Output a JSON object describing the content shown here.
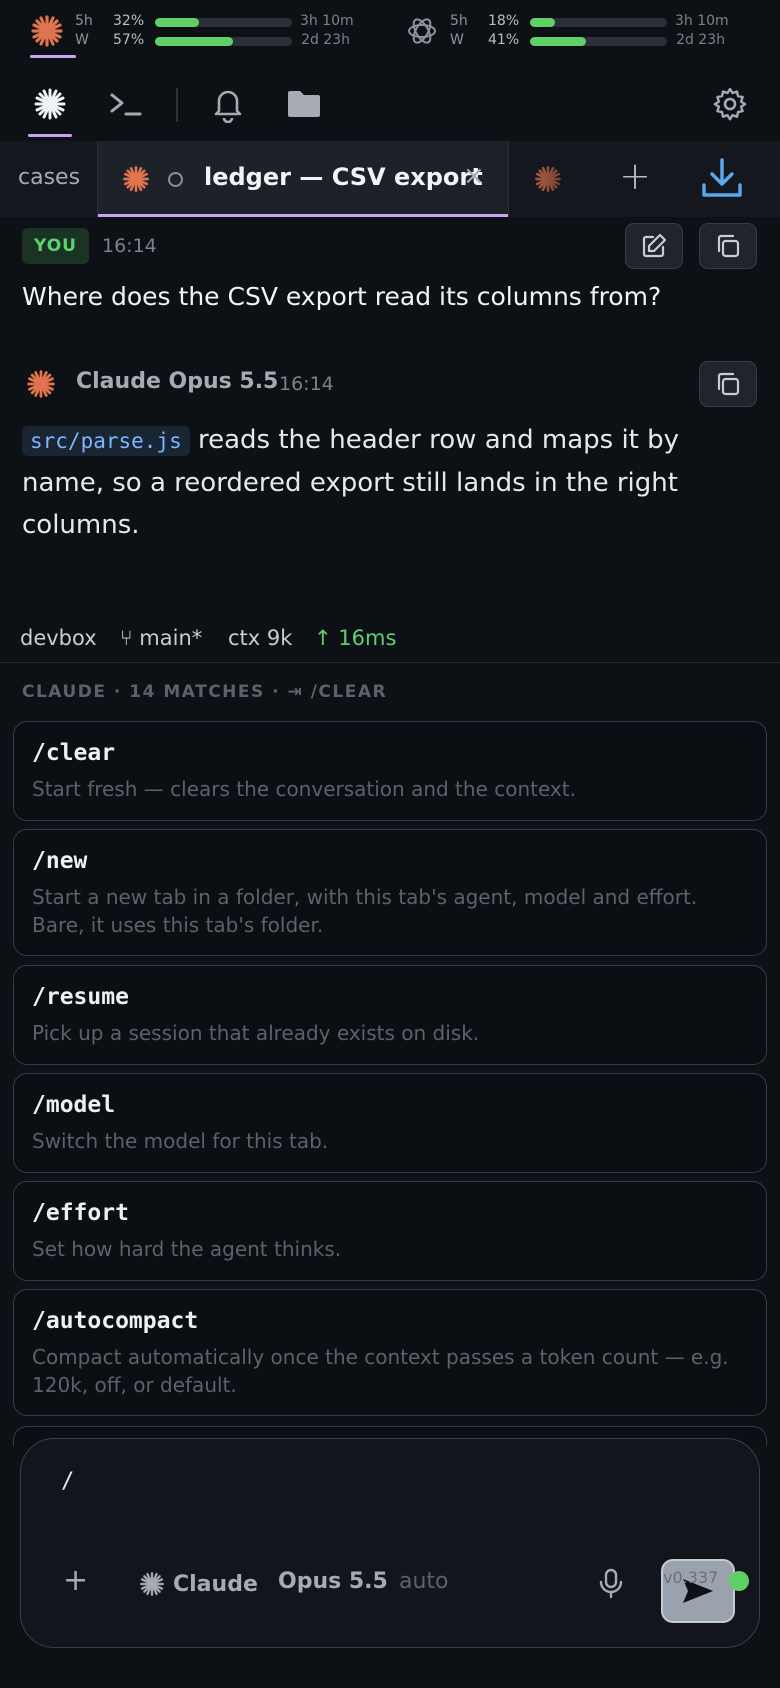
{
  "colors": {
    "accent": "#c9a4f0",
    "claude_brand": "#e0744e",
    "usage_fill": "#5fd068",
    "status_ok": "#5ed170",
    "code_text": "#7cb6ff",
    "background": "#0d1015"
  },
  "usage": {
    "claude": {
      "icon": "claude-logo-icon",
      "session": {
        "label": "5h",
        "percent_text": "32%",
        "percent": 32,
        "reset": "3h 10m"
      },
      "weekly": {
        "label": "W",
        "percent_text": "57%",
        "percent": 57,
        "reset": "2d 23h"
      }
    },
    "openai": {
      "icon": "openai-logo-icon",
      "session": {
        "label": "5h",
        "percent_text": "18%",
        "percent": 18,
        "reset": "3h 10m"
      },
      "weekly": {
        "label": "W",
        "percent_text": "41%",
        "percent": 41,
        "reset": "2d 23h"
      }
    }
  },
  "toolbar": {
    "icons": [
      "claude-logo-icon",
      "terminal-icon",
      "bell-icon",
      "folder-icon",
      "gear-icon"
    ]
  },
  "tabs": {
    "prev_label": "cases",
    "active": {
      "title": "ledger — CSV export",
      "close": "×"
    },
    "next_label": "",
    "add_label": "+"
  },
  "messages": {
    "user": {
      "badge": "YOU",
      "time": "16:14",
      "text": "Where does the CSV export read its columns from?"
    },
    "assistant": {
      "name": "Claude Opus 5.5",
      "time": "16:14",
      "code": "src/parse.js",
      "text": " reads the header row and maps it by name, so a reordered export still lands in the right columns."
    }
  },
  "status": {
    "host": "devbox",
    "branch": "main*",
    "ctx": "ctx 9k",
    "latency": "↑ 16ms"
  },
  "palette": {
    "header": "CLAUDE · 14 MATCHES · ⇥ /CLEAR",
    "commands": [
      {
        "name": "/clear",
        "desc": "Start fresh — clears the conversation and the context."
      },
      {
        "name": "/new",
        "desc": "Start a new tab in a folder, with this tab's agent, model and effort. Bare, it uses this tab's folder."
      },
      {
        "name": "/resume",
        "desc": "Pick up a session that already exists on disk."
      },
      {
        "name": "/model",
        "desc": "Switch the model for this tab."
      },
      {
        "name": "/effort",
        "desc": "Set how hard the agent thinks."
      },
      {
        "name": "/autocompact",
        "desc": "Compact automatically once the context passes a token count — e.g. 120k, off, or default."
      }
    ]
  },
  "composer": {
    "value": "/",
    "plus": "+",
    "agent": "Claude",
    "model": "Opus 5.5",
    "effort": "auto"
  },
  "footer": {
    "version": "v0.337"
  }
}
